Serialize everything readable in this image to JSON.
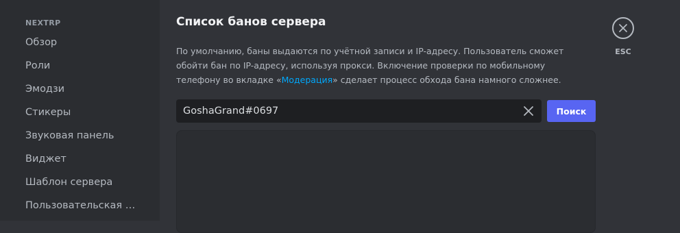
{
  "sidebar": {
    "header": "NEXTRP",
    "items": [
      {
        "label": "Обзор"
      },
      {
        "label": "Роли"
      },
      {
        "label": "Эмодзи"
      },
      {
        "label": "Стикеры"
      },
      {
        "label": "Звуковая панель"
      },
      {
        "label": "Виджет"
      },
      {
        "label": "Шаблон сервера"
      },
      {
        "label": "Пользовательская ссылка"
      }
    ]
  },
  "main": {
    "title": "Список банов сервера",
    "description": {
      "before_link": "По умолчанию, баны выдаются по учётной записи и IP-адресу. Пользователь сможет обойти бан по IP-адресу, используя прокси. Включение проверки по мобильному телефону во вкладке «",
      "link": "Модерация",
      "after_link": "» сделает процесс обхода бана намного сложнее."
    },
    "search": {
      "value": "GoshaGrand#0697",
      "clear_icon": "close-icon",
      "button_label": "Поиск"
    }
  },
  "close": {
    "icon": "close-circle-icon",
    "label": "ESC"
  },
  "colors": {
    "background": "#313338",
    "sidebar": "#2b2d31",
    "accent": "#5865f2",
    "link": "#00a8fc"
  }
}
